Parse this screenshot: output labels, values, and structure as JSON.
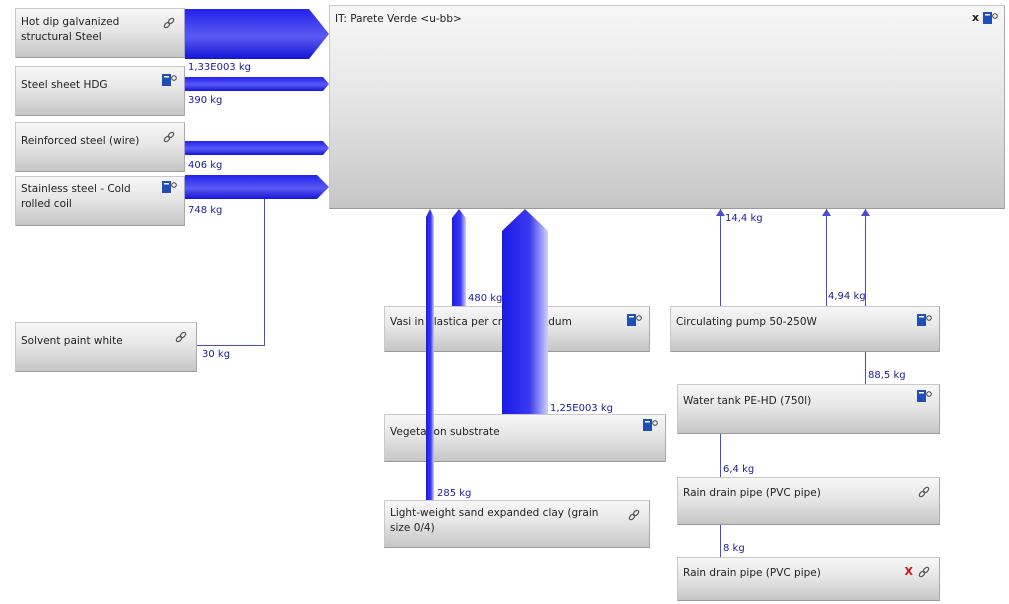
{
  "process": {
    "title": "IT: Parete Verde <u-bb>"
  },
  "boxes": {
    "hdg_struct": {
      "label": "Hot dip galvanized structural Steel"
    },
    "sheet_hdg": {
      "label": "Steel sheet HDG"
    },
    "rebar": {
      "label": "Reinforced steel (wire)"
    },
    "stainless": {
      "label": "Stainless steel - Cold rolled coil"
    },
    "paint": {
      "label": "Solvent paint white"
    },
    "vasi": {
      "label": "Vasi in Plastica per crescita sedum"
    },
    "veg": {
      "label": "Vegetation substrate"
    },
    "clay": {
      "label": "Light-weight sand expanded clay (grain size 0/4)"
    },
    "pump": {
      "label": "Circulating pump 50-250W"
    },
    "tank": {
      "label": "Water tank PE-HD (750l)"
    },
    "pipe1": {
      "label": "Rain drain pipe (PVC pipe)"
    },
    "pipe2": {
      "label": "Rain drain pipe (PVC pipe)",
      "marker": "X"
    }
  },
  "flows": {
    "hdg_struct": "1,33E003 kg",
    "sheet_hdg": "390 kg",
    "rebar": "406 kg",
    "stainless": "748 kg",
    "paint": "30 kg",
    "vasi": "480 kg",
    "veg": "1,25E003 kg",
    "clay": "285 kg",
    "pump_out": "14,4 kg",
    "pump_in": "4,94 kg",
    "tank": "88,5 kg",
    "pipe1": "6,4 kg",
    "pipe2": "8 kg"
  },
  "icons": {
    "plan": "plan-icon",
    "link": "link-icon",
    "close": "close-x-icon"
  },
  "colors": {
    "flow": "#2020e8",
    "flow_light": "#d8d8f8",
    "label": "#1a1a9a"
  }
}
